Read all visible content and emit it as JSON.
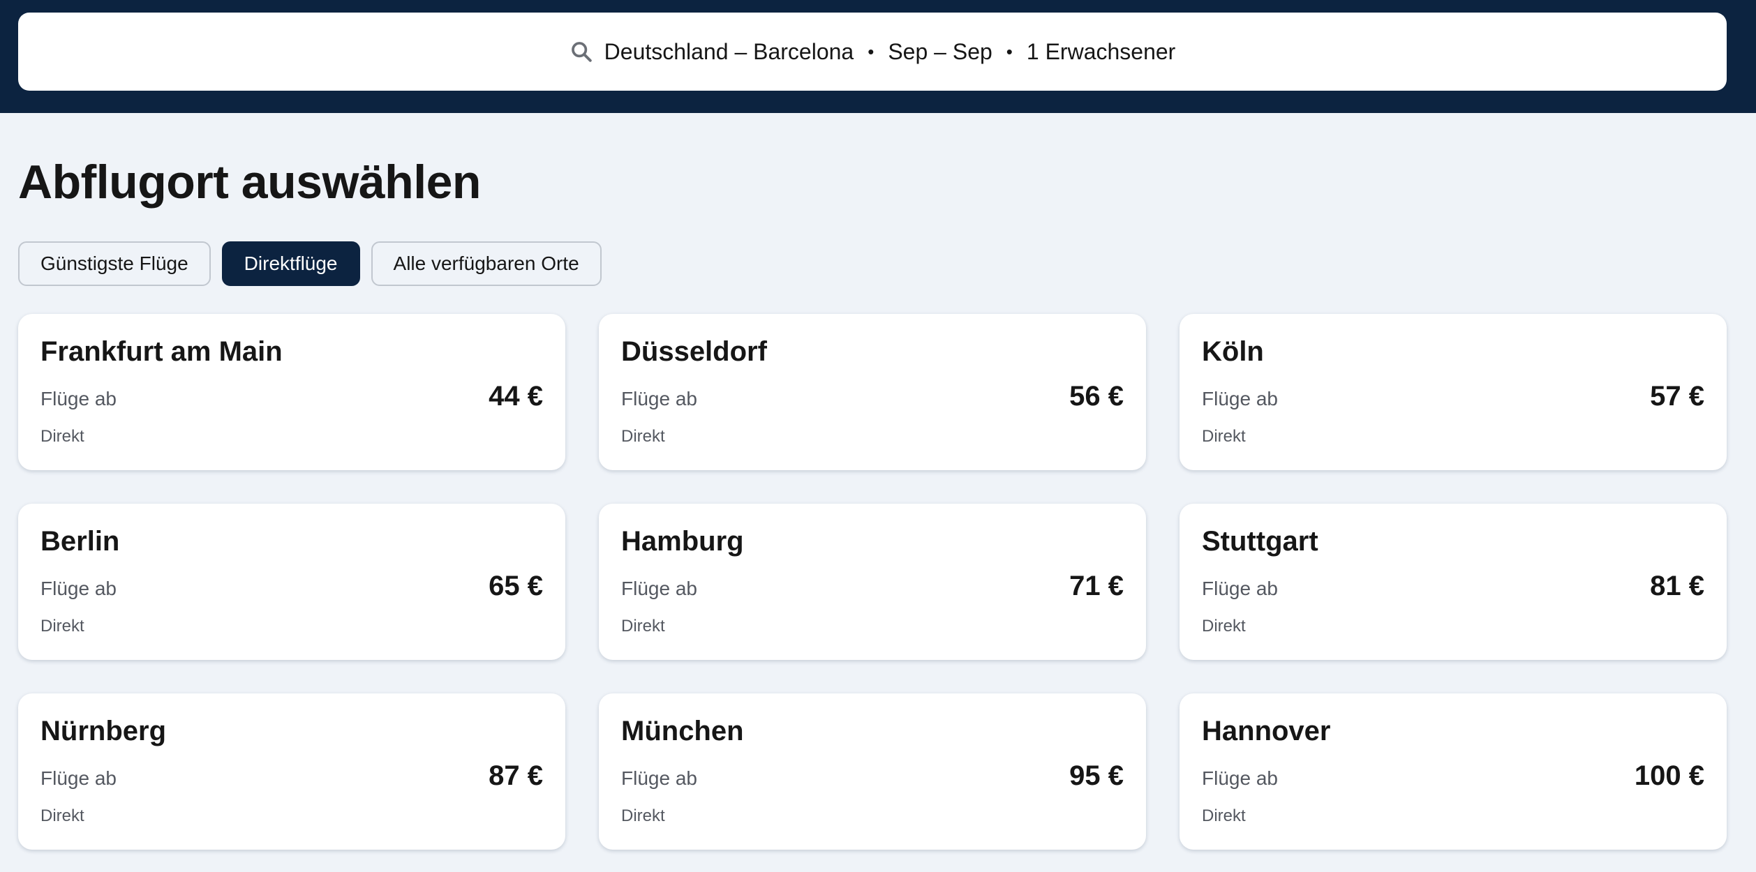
{
  "search": {
    "route": "Deutschland – Barcelona",
    "dates": "Sep – Sep",
    "travellers": "1 Erwachsener",
    "separator": "•"
  },
  "page": {
    "title": "Abflugort auswählen"
  },
  "filters": [
    {
      "label": "Günstigste Flüge",
      "active": false
    },
    {
      "label": "Direktflüge",
      "active": true
    },
    {
      "label": "Alle verfügbaren Orte",
      "active": false
    }
  ],
  "cards": [
    {
      "city": "Frankfurt am Main",
      "from_label": "Flüge ab",
      "price": "44 €",
      "stops": "Direkt"
    },
    {
      "city": "Düsseldorf",
      "from_label": "Flüge ab",
      "price": "56 €",
      "stops": "Direkt"
    },
    {
      "city": "Köln",
      "from_label": "Flüge ab",
      "price": "57 €",
      "stops": "Direkt"
    },
    {
      "city": "Berlin",
      "from_label": "Flüge ab",
      "price": "65 €",
      "stops": "Direkt"
    },
    {
      "city": "Hamburg",
      "from_label": "Flüge ab",
      "price": "71 €",
      "stops": "Direkt"
    },
    {
      "city": "Stuttgart",
      "from_label": "Flüge ab",
      "price": "81 €",
      "stops": "Direkt"
    },
    {
      "city": "Nürnberg",
      "from_label": "Flüge ab",
      "price": "87 €",
      "stops": "Direkt"
    },
    {
      "city": "München",
      "from_label": "Flüge ab",
      "price": "95 €",
      "stops": "Direkt"
    },
    {
      "city": "Hannover",
      "from_label": "Flüge ab",
      "price": "100 €",
      "stops": "Direkt"
    }
  ],
  "colors": {
    "header_bg": "#0c2340",
    "page_bg": "#eff3f8",
    "active_chip": "#0c2340"
  },
  "icons": {
    "search": "search-icon"
  }
}
